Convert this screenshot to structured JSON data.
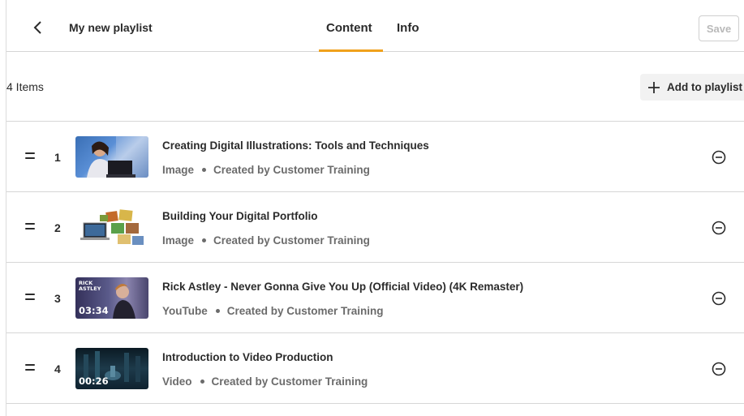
{
  "header": {
    "title": "My new playlist",
    "tabs": [
      {
        "label": "Content",
        "active": true
      },
      {
        "label": "Info",
        "active": false
      }
    ],
    "save_label": "Save"
  },
  "toolbar": {
    "items_count": "4 Items",
    "add_label": "Add to playlist"
  },
  "colors": {
    "accent_underline": "#f0a11c",
    "text": "#2b2b2b",
    "muted": "#6b6b6b"
  },
  "items": [
    {
      "number": "1",
      "title": "Creating Digital Illustrations: Tools and Techniques",
      "type": "Image",
      "creator": "Created by Customer Training",
      "duration": "",
      "thumb_icon": "woman-laptop-image"
    },
    {
      "number": "2",
      "title": "Building Your Digital Portfolio",
      "type": "Image",
      "creator": "Created by Customer Training",
      "duration": "",
      "thumb_icon": "portfolio-collage-image"
    },
    {
      "number": "3",
      "title": "Rick Astley - Never Gonna Give You Up (Official Video) (4K Remaster)",
      "type": "YouTube",
      "creator": "Created by Customer Training",
      "duration": "03:34",
      "thumb_text": "RICK ASTLEY",
      "thumb_icon": "music-video-thumbnail"
    },
    {
      "number": "4",
      "title": "Introduction to Video Production",
      "type": "Video",
      "creator": "Created by Customer Training",
      "duration": "00:26",
      "thumb_icon": "video-thumbnail"
    }
  ]
}
